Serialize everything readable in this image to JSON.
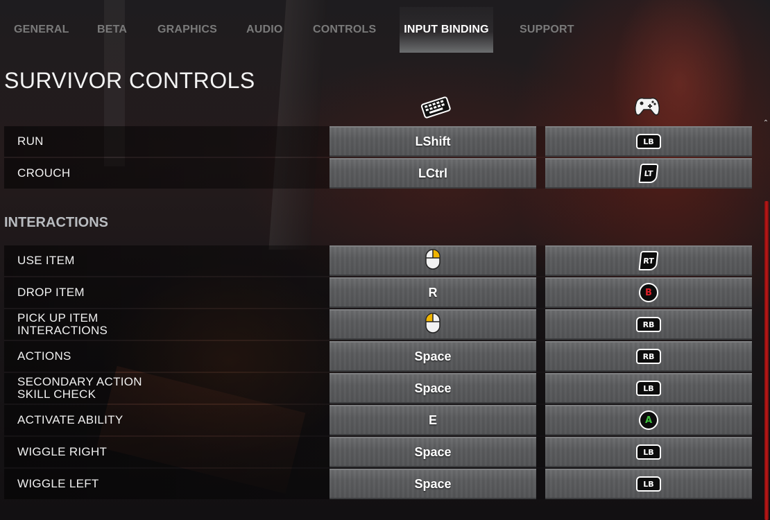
{
  "tabs": [
    {
      "label": "GENERAL",
      "active": false
    },
    {
      "label": "BETA",
      "active": false
    },
    {
      "label": "GRAPHICS",
      "active": false
    },
    {
      "label": "AUDIO",
      "active": false
    },
    {
      "label": "CONTROLS",
      "active": false
    },
    {
      "label": "INPUT BINDING",
      "active": true
    },
    {
      "label": "SUPPORT",
      "active": false
    }
  ],
  "section_title": "SURVIVOR CONTROLS",
  "columns": {
    "keyboard_icon": "keyboard-icon",
    "gamepad_icon": "gamepad-icon"
  },
  "movement_rows": [
    {
      "label_lines": [
        "RUN"
      ],
      "keyboard": "LShift",
      "gamepad": "LB"
    },
    {
      "label_lines": [
        "CROUCH"
      ],
      "keyboard": "LCtrl",
      "gamepad": "LT"
    }
  ],
  "interactions_title": "INTERACTIONS",
  "interaction_rows": [
    {
      "label_lines": [
        "USE ITEM"
      ],
      "keyboard_icon": "mouse-right-button-icon",
      "gamepad": "RT"
    },
    {
      "label_lines": [
        "DROP ITEM"
      ],
      "keyboard": "R",
      "gamepad": "B"
    },
    {
      "label_lines": [
        "PICK UP ITEM",
        "INTERACTIONS"
      ],
      "keyboard_icon": "mouse-left-button-icon",
      "gamepad": "RB"
    },
    {
      "label_lines": [
        "ACTIONS"
      ],
      "keyboard": "Space",
      "gamepad": "RB"
    },
    {
      "label_lines": [
        "SECONDARY ACTION",
        "SKILL CHECK"
      ],
      "keyboard": "Space",
      "gamepad": "LB"
    },
    {
      "label_lines": [
        "ACTIVATE ABILITY"
      ],
      "keyboard": "E",
      "gamepad": "A"
    },
    {
      "label_lines": [
        "WIGGLE RIGHT"
      ],
      "keyboard": "Space",
      "gamepad": "LB"
    },
    {
      "label_lines": [
        "WIGGLE LEFT"
      ],
      "keyboard": "Space",
      "gamepad": "LB"
    }
  ],
  "colors": {
    "accent_red": "#c01818",
    "b_button": "#e0202a",
    "a_button": "#3cc23c"
  }
}
